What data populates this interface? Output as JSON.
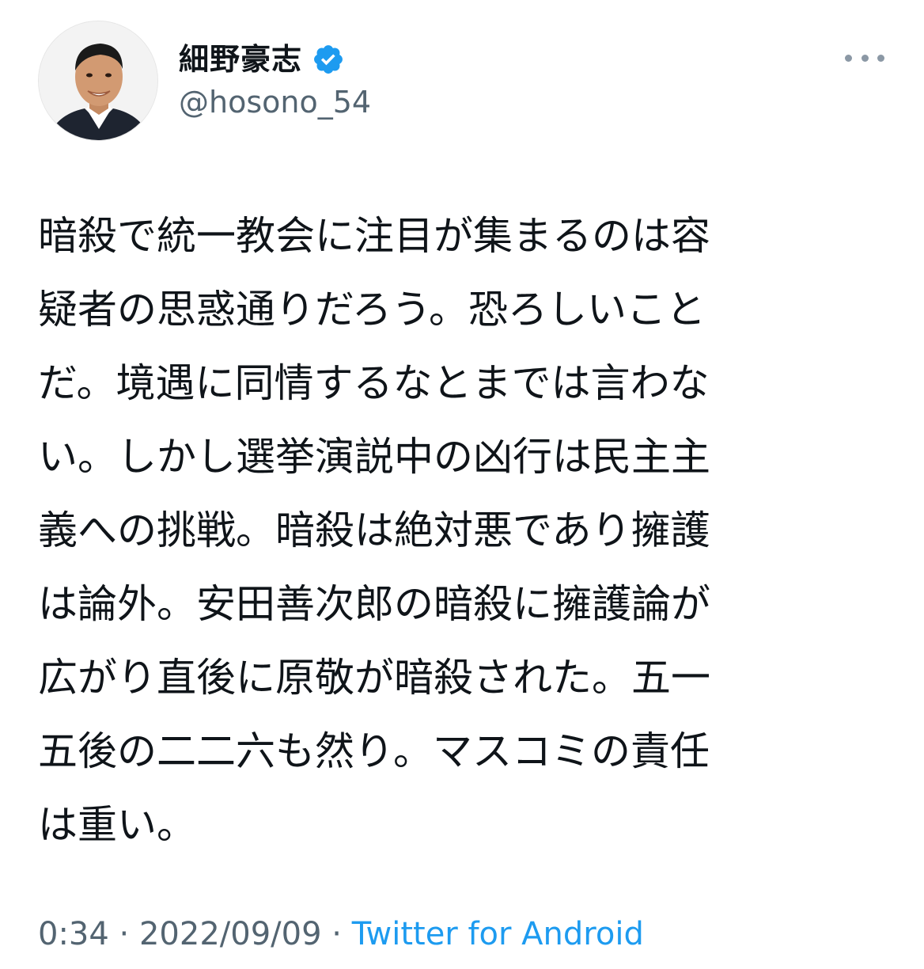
{
  "tweet": {
    "author": {
      "display_name": "細野豪志",
      "handle": "@hosono_54",
      "verified": true,
      "avatar_icon": "profile-photo"
    },
    "more_icon": "more-horizontal-icon",
    "text_lines": [
      "暗殺で統一教会に注目が集まるのは容",
      "疑者の思惑通りだろう。恐ろしいこと",
      "だ。境遇に同情するなとまでは言わな",
      "い。しかし選挙演説中の凶行は民主主",
      "義への挑戦。暗殺は絶対悪であり擁護",
      "は論外。安田善次郎の暗殺に擁護論が",
      "広がり直後に原敬が暗殺された。五一",
      "五後の二二六も然り。マスコミの責任",
      "は重い。"
    ],
    "time": "0:34",
    "separator": " · ",
    "date": "2022/09/09",
    "source": "Twitter for Android"
  },
  "colors": {
    "text_primary": "#0f1419",
    "text_secondary": "#536471",
    "accent": "#1d9bf0"
  }
}
